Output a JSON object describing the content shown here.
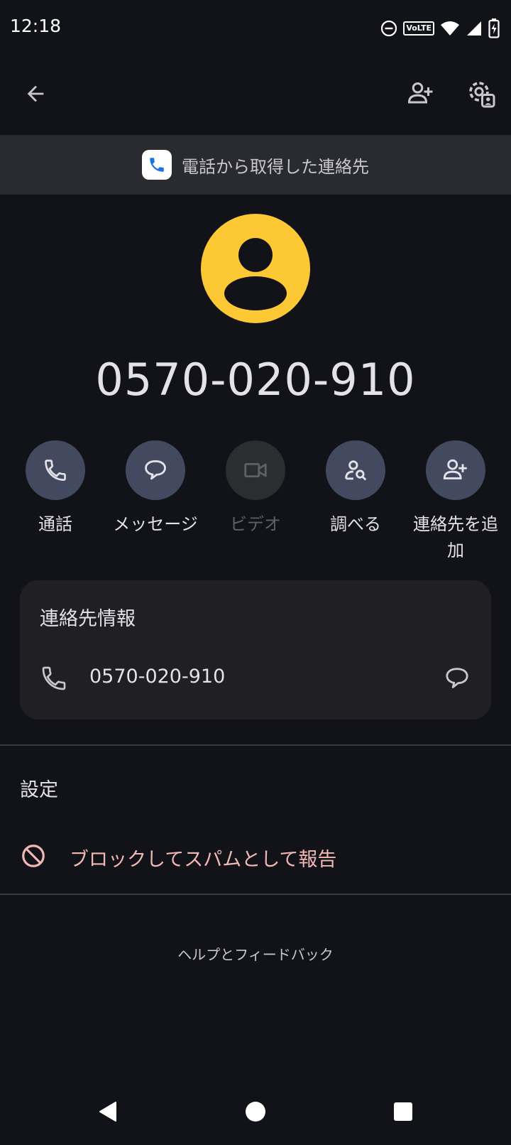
{
  "status_bar": {
    "time": "12:18",
    "volte_label": "VoLTE"
  },
  "app_bar": {
    "back_icon": "arrow-back-icon",
    "add_contact_icon": "person-add-icon",
    "settings_icon": "manage-accounts-icon"
  },
  "source_banner": {
    "text": "電話から取得した連絡先",
    "icon": "phone-app-icon"
  },
  "contact": {
    "number": "0570-020-910",
    "avatar_color": "#fcc934"
  },
  "actions": [
    {
      "label": "通話",
      "icon": "phone-icon",
      "enabled": true
    },
    {
      "label": "メッセージ",
      "icon": "message-icon",
      "enabled": true
    },
    {
      "label": "ビデオ",
      "icon": "videocam-icon",
      "enabled": false
    },
    {
      "label": "調べる",
      "icon": "person-search-icon",
      "enabled": true
    },
    {
      "label": "連絡先を追加",
      "icon": "person-add-icon",
      "enabled": true
    }
  ],
  "info_card": {
    "title": "連絡先情報",
    "phone_number": "0570-020-910"
  },
  "settings": {
    "heading": "設定",
    "block_label": "ブロックしてスパムとして報告",
    "block_color": "#f2b8b5"
  },
  "footer": {
    "help_label": "ヘルプとフィードバック"
  },
  "colors": {
    "background": "#121318",
    "action_circle": "#434a5f",
    "card": "#1f1f24"
  }
}
